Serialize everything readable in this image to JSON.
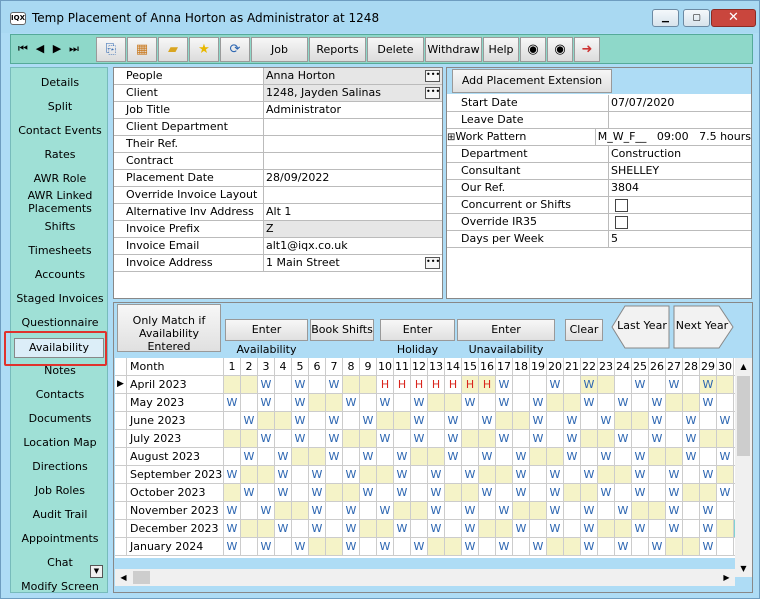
{
  "window": {
    "title": "Temp Placement of Anna Horton as Administrator at 1248",
    "app_icon_label": "IQX"
  },
  "toolbar": {
    "nav": [
      "⏮",
      "◀",
      "▶",
      "⏭"
    ],
    "buttons": [
      "Job",
      "Reports",
      "Delete",
      "Withdraw",
      "Help"
    ],
    "icons": [
      "copy-icon",
      "calendar-icon",
      "folder-icon",
      "star-icon",
      "refresh-icon",
      "export-icon",
      "import-icon",
      "exit-icon"
    ]
  },
  "sidebar": {
    "items": [
      "Details",
      "Split",
      "Contact Events",
      "Rates",
      "AWR Role",
      "AWR Linked Placements",
      "Shifts",
      "Timesheets",
      "Accounts",
      "Staged Invoices",
      "Questionnaire",
      "Availability",
      "Notes",
      "Contacts",
      "Documents",
      "Location Map",
      "Directions",
      "Job Roles",
      "Audit Trail",
      "Appointments",
      "Chat",
      "Modify Screen"
    ],
    "selected": "Availability"
  },
  "left_fields": [
    {
      "label": "People",
      "value": "Anna Horton",
      "grey": true,
      "dots": true
    },
    {
      "label": "Client",
      "value": "1248, Jayden Salinas",
      "grey": true,
      "dots": true
    },
    {
      "label": "Job Title",
      "value": "Administrator",
      "grey": false,
      "dots": false
    },
    {
      "label": "Client Department",
      "value": "",
      "grey": false,
      "dots": false
    },
    {
      "label": "Their Ref.",
      "value": "",
      "grey": false,
      "dots": false
    },
    {
      "label": "Contract",
      "value": "",
      "grey": false,
      "dots": false
    },
    {
      "label": "Placement Date",
      "value": "28/09/2022",
      "grey": false,
      "dots": false
    },
    {
      "label": "Override Invoice Layout",
      "value": "",
      "grey": false,
      "dots": false
    },
    {
      "label": "Alternative Inv Address",
      "value": "Alt 1",
      "grey": false,
      "dots": false
    },
    {
      "label": "Invoice Prefix",
      "value": "Z",
      "grey": true,
      "dots": false
    },
    {
      "label": "Invoice Email",
      "value": "alt1@iqx.co.uk",
      "grey": false,
      "dots": false
    },
    {
      "label": "Invoice Address",
      "value": "1 Main Street",
      "grey": false,
      "dots": true
    }
  ],
  "right_panel": {
    "extension_button": "Add Placement Extension",
    "fields": [
      {
        "label": "Start Date",
        "value": "07/07/2020",
        "check": false
      },
      {
        "label": "Leave Date",
        "value": "",
        "check": false
      },
      {
        "label": "Work Pattern",
        "value": "M_W_F__   09:00   7.5 hours",
        "check": false,
        "expand": "⊞"
      },
      {
        "label": "Department",
        "value": "Construction",
        "check": false
      },
      {
        "label": "Consultant",
        "value": "SHELLEY",
        "check": false
      },
      {
        "label": "Our Ref.",
        "value": "3804",
        "check": false
      },
      {
        "label": "Concurrent or Shifts",
        "value": "",
        "check": true
      },
      {
        "label": "Override IR35",
        "value": "",
        "check": true
      },
      {
        "label": "Days per Week",
        "value": "5",
        "check": false
      }
    ]
  },
  "calendar": {
    "buttons": {
      "only_match": "Only Match if Availability Entered",
      "enter_availability": "Enter Availability",
      "book_shifts": "Book Shifts",
      "enter_holiday": "Enter Holiday",
      "enter_unavailability": "Enter Unavailability",
      "clear": "Clear",
      "last_year": "Last Year",
      "next_year": "Next Year"
    },
    "month_header": "Month",
    "days": [
      "1",
      "2",
      "3",
      "4",
      "5",
      "6",
      "7",
      "8",
      "9",
      "10",
      "11",
      "12",
      "13",
      "14",
      "15",
      "16",
      "17",
      "18",
      "19",
      "20",
      "21",
      "22",
      "23",
      "24",
      "25",
      "26",
      "27",
      "28",
      "29",
      "30",
      "31"
    ],
    "rows": [
      {
        "month": "April 2023",
        "current": true,
        "cells": [
          "",
          "",
          "W",
          "",
          "W",
          "",
          "W",
          "",
          "",
          "H",
          "H",
          "H",
          "H",
          "H",
          "H",
          "H",
          "W",
          "",
          "",
          "W",
          "",
          "W",
          "",
          "",
          "W",
          "",
          "W",
          "",
          "W",
          "",
          ""
        ],
        "shade": [
          1,
          2,
          8,
          9,
          15,
          16,
          22,
          23,
          29,
          30
        ]
      },
      {
        "month": "May 2023",
        "current": false,
        "cells": [
          "W",
          "",
          "W",
          "",
          "W",
          "",
          "",
          "W",
          "",
          "W",
          "",
          "W",
          "",
          "",
          "W",
          "",
          "W",
          "",
          "W",
          "",
          "",
          "W",
          "",
          "W",
          "",
          "W",
          "",
          "",
          "W",
          "",
          "W"
        ],
        "shade": [
          6,
          7,
          13,
          14,
          20,
          21,
          27,
          28
        ]
      },
      {
        "month": "June 2023",
        "current": false,
        "cells": [
          "",
          "W",
          "",
          "",
          "W",
          "",
          "W",
          "",
          "W",
          "",
          "",
          "W",
          "",
          "W",
          "",
          "W",
          "",
          "",
          "W",
          "",
          "W",
          "",
          "W",
          "",
          "",
          "W",
          "",
          "W",
          "",
          "W",
          ""
        ],
        "shade": [
          3,
          4,
          10,
          11,
          17,
          18,
          24,
          25
        ]
      },
      {
        "month": "July 2023",
        "current": false,
        "cells": [
          "",
          "",
          "W",
          "",
          "W",
          "",
          "W",
          "",
          "",
          "W",
          "",
          "W",
          "",
          "W",
          "",
          "",
          "W",
          "",
          "W",
          "",
          "W",
          "",
          "",
          "W",
          "",
          "W",
          "",
          "W",
          "",
          "",
          "W"
        ],
        "shade": [
          1,
          2,
          8,
          9,
          15,
          16,
          22,
          23,
          29,
          30
        ]
      },
      {
        "month": "August 2023",
        "current": false,
        "cells": [
          "",
          "W",
          "",
          "W",
          "",
          "",
          "W",
          "",
          "W",
          "",
          "W",
          "",
          "",
          "W",
          "",
          "W",
          "",
          "W",
          "",
          "",
          "W",
          "",
          "W",
          "",
          "W",
          "",
          "",
          "W",
          "",
          "W",
          ""
        ],
        "shade": [
          5,
          6,
          12,
          13,
          19,
          20,
          26,
          27
        ]
      },
      {
        "month": "September 2023",
        "current": false,
        "cells": [
          "W",
          "",
          "",
          "W",
          "",
          "W",
          "",
          "W",
          "",
          "",
          "W",
          "",
          "W",
          "",
          "W",
          "",
          "",
          "W",
          "",
          "W",
          "",
          "W",
          "",
          "",
          "W",
          "",
          "W",
          "",
          "W",
          "",
          ""
        ],
        "shade": [
          2,
          3,
          9,
          10,
          16,
          17,
          23,
          24,
          30
        ]
      },
      {
        "month": "October 2023",
        "current": false,
        "cells": [
          "",
          "W",
          "",
          "W",
          "",
          "W",
          "",
          "",
          "W",
          "",
          "W",
          "",
          "W",
          "",
          "",
          "W",
          "",
          "W",
          "",
          "W",
          "",
          "",
          "W",
          "",
          "W",
          "",
          "W",
          "",
          "",
          "W",
          ""
        ],
        "shade": [
          1,
          7,
          8,
          14,
          15,
          21,
          22,
          28,
          29
        ]
      },
      {
        "month": "November 2023",
        "current": false,
        "cells": [
          "W",
          "",
          "W",
          "",
          "",
          "W",
          "",
          "W",
          "",
          "W",
          "",
          "",
          "W",
          "",
          "W",
          "",
          "W",
          "",
          "",
          "W",
          "",
          "W",
          "",
          "W",
          "",
          "",
          "W",
          "",
          "W",
          "",
          ""
        ],
        "shade": [
          4,
          5,
          11,
          12,
          18,
          19,
          25,
          26
        ]
      },
      {
        "month": "December 2023",
        "current": false,
        "cells": [
          "W",
          "",
          "",
          "W",
          "",
          "W",
          "",
          "W",
          "",
          "",
          "W",
          "",
          "W",
          "",
          "W",
          "",
          "",
          "W",
          "",
          "W",
          "",
          "W",
          "",
          "",
          "W",
          "",
          "W",
          "",
          "W",
          "",
          ""
        ],
        "shade": [
          2,
          3,
          9,
          10,
          16,
          17,
          23,
          24,
          30,
          31
        ]
      },
      {
        "month": "January 2024",
        "current": false,
        "cells": [
          "W",
          "",
          "W",
          "",
          "W",
          "",
          "",
          "W",
          "",
          "W",
          "",
          "W",
          "",
          "",
          "W",
          "",
          "W",
          "",
          "W",
          "",
          "",
          "W",
          "",
          "W",
          "",
          "W",
          "",
          "",
          "W",
          "",
          "W"
        ],
        "shade": [
          6,
          7,
          13,
          14,
          20,
          21,
          27,
          28
        ]
      }
    ]
  },
  "colors": {
    "shade": "#f5f3c8",
    "teal_cell": "#7fd3d3",
    "holiday": "#d9251d",
    "work": "#2a64b0"
  }
}
